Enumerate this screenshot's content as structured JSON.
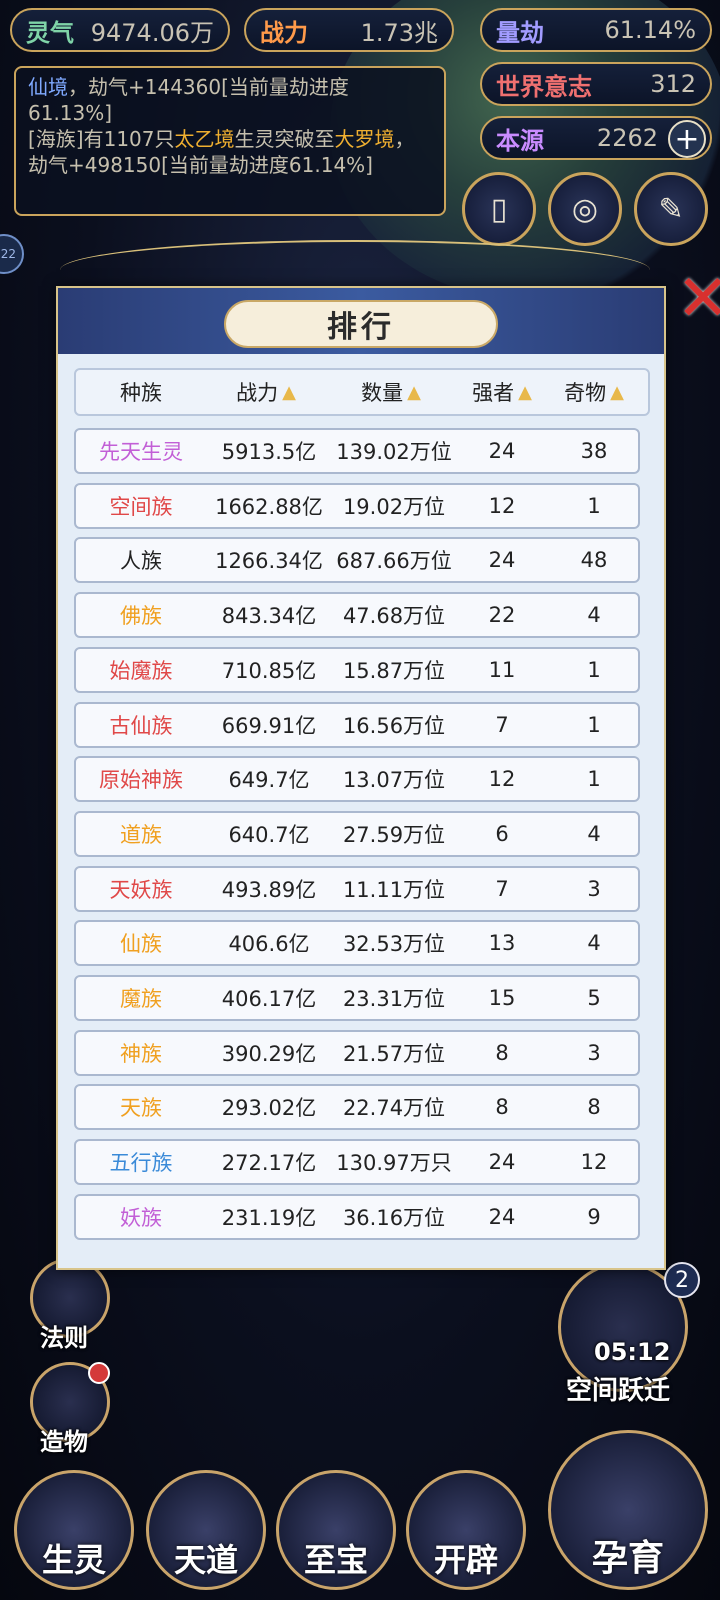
{
  "top_stats": {
    "lingqi": {
      "label": "灵气",
      "value": "9474.06万"
    },
    "zhanli": {
      "label": "战力",
      "value": "1.73兆"
    },
    "liangjie": {
      "label": "量劫",
      "value": "61.14%"
    },
    "shijie": {
      "label": "世界意志",
      "value": "312"
    },
    "benyuan": {
      "label": "本源",
      "value": "2262"
    }
  },
  "log": {
    "line1_prefix": "仙境",
    "line1_rest": "，劫气+144360[当前量劫进度61.13%]",
    "line2_a": "[海族]有1107只",
    "line2_b": "太乙境",
    "line2_c": "生灵突破至",
    "line2_d": "大罗境",
    "line2_e": "，劫气+498150[当前量劫进度61.14%]"
  },
  "side_buttons": {
    "fa_ze": "法则",
    "zao_wu": "造物",
    "space_jump": "空间跃迁",
    "space_timer": "05:12",
    "space_badge": "2",
    "left_badge": "22"
  },
  "bottom_nav": {
    "sheng_ling": "生灵",
    "tian_dao": "天道",
    "zhi_bao": "至宝",
    "kai_pi": "开辟",
    "yun_yu": "孕育"
  },
  "modal": {
    "title": "排行",
    "headers": {
      "race": "种族",
      "power": "战力",
      "count": "数量",
      "strong": "强者",
      "artifact": "奇物"
    },
    "rows": [
      {
        "race": "先天生灵",
        "color": "#c25fd6",
        "power": "5913.5亿",
        "count": "139.02万位",
        "strong": "24",
        "artifact": "38"
      },
      {
        "race": "空间族",
        "color": "#e04848",
        "power": "1662.88亿",
        "count": "19.02万位",
        "strong": "12",
        "artifact": "1"
      },
      {
        "race": "人族",
        "color": "#222222",
        "power": "1266.34亿",
        "count": "687.66万位",
        "strong": "24",
        "artifact": "48"
      },
      {
        "race": "佛族",
        "color": "#f0a020",
        "power": "843.34亿",
        "count": "47.68万位",
        "strong": "22",
        "artifact": "4"
      },
      {
        "race": "始魔族",
        "color": "#e04848",
        "power": "710.85亿",
        "count": "15.87万位",
        "strong": "11",
        "artifact": "1"
      },
      {
        "race": "古仙族",
        "color": "#e04848",
        "power": "669.91亿",
        "count": "16.56万位",
        "strong": "7",
        "artifact": "1"
      },
      {
        "race": "原始神族",
        "color": "#e04848",
        "power": "649.7亿",
        "count": "13.07万位",
        "strong": "12",
        "artifact": "1"
      },
      {
        "race": "道族",
        "color": "#f0a020",
        "power": "640.7亿",
        "count": "27.59万位",
        "strong": "6",
        "artifact": "4"
      },
      {
        "race": "天妖族",
        "color": "#e04848",
        "power": "493.89亿",
        "count": "11.11万位",
        "strong": "7",
        "artifact": "3"
      },
      {
        "race": "仙族",
        "color": "#f0a020",
        "power": "406.6亿",
        "count": "32.53万位",
        "strong": "13",
        "artifact": "4"
      },
      {
        "race": "魔族",
        "color": "#f0a020",
        "power": "406.17亿",
        "count": "23.31万位",
        "strong": "15",
        "artifact": "5"
      },
      {
        "race": "神族",
        "color": "#f0a020",
        "power": "390.29亿",
        "count": "21.57万位",
        "strong": "8",
        "artifact": "3"
      },
      {
        "race": "天族",
        "color": "#f0a020",
        "power": "293.02亿",
        "count": "22.74万位",
        "strong": "8",
        "artifact": "8"
      },
      {
        "race": "五行族",
        "color": "#3a8ad8",
        "power": "272.17亿",
        "count": "130.97万只",
        "strong": "24",
        "artifact": "12"
      },
      {
        "race": "妖族",
        "color": "#c25fd6",
        "power": "231.19亿",
        "count": "36.16万位",
        "strong": "24",
        "artifact": "9"
      }
    ]
  }
}
